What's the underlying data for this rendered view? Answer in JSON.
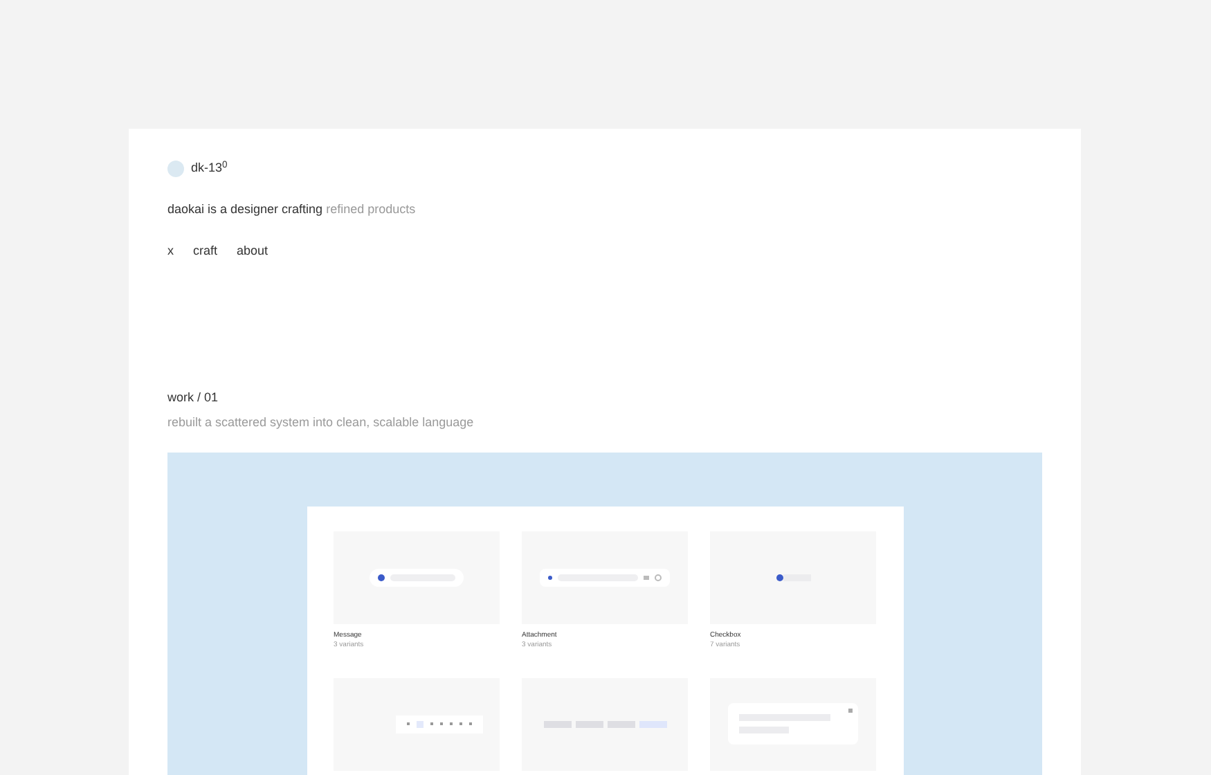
{
  "brand": {
    "name": "dk-13$^{0}$"
  },
  "tagline": {
    "lead": "daokai is a designer crafting",
    "muted": "refined products"
  },
  "nav": [
    "x",
    "craft",
    "about"
  ],
  "work": {
    "title": "work / 01",
    "subtitle": "rebuilt a scattered system into clean, scalable language",
    "cards": [
      {
        "kind": "message",
        "label": "Message",
        "count": "3 variants"
      },
      {
        "kind": "attachment",
        "label": "Attachment",
        "count": "3 variants"
      },
      {
        "kind": "checkbox",
        "label": "Checkbox",
        "count": "7 variants"
      },
      {
        "kind": "pagination"
      },
      {
        "kind": "steps"
      },
      {
        "kind": "dialog"
      }
    ]
  }
}
